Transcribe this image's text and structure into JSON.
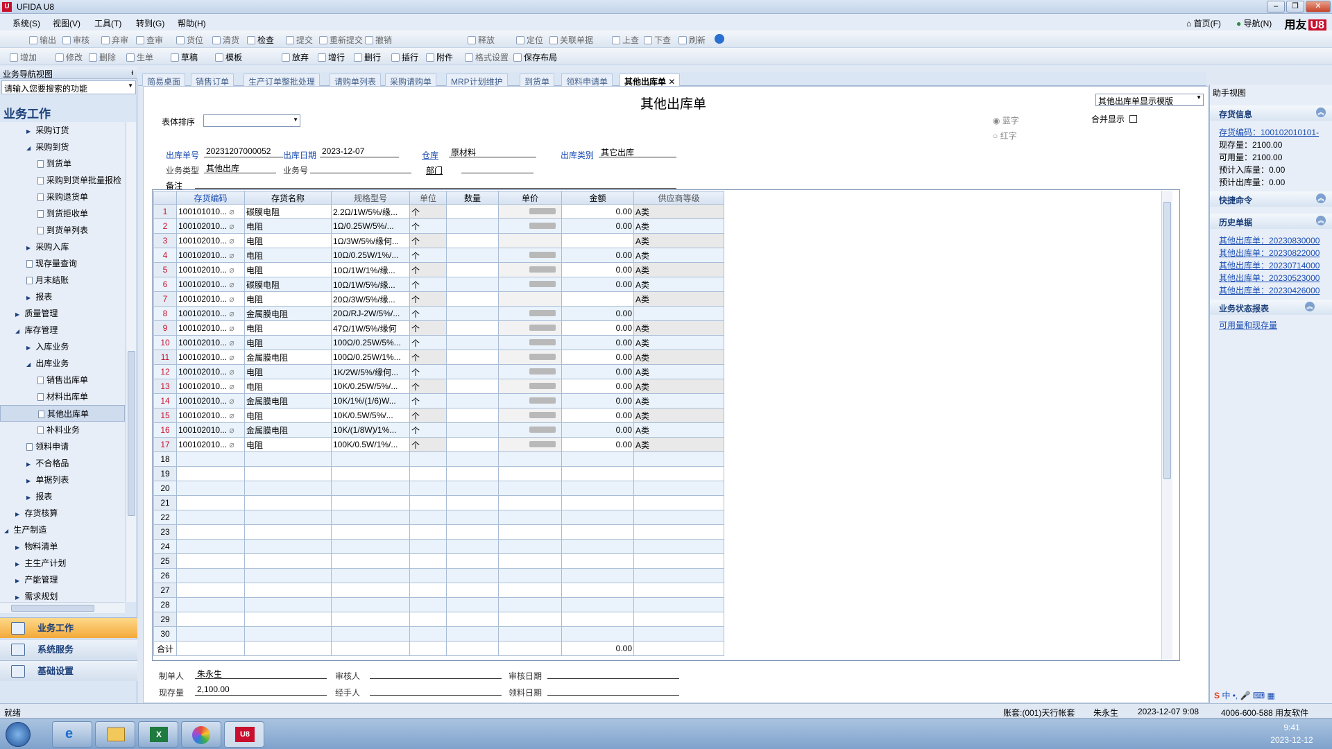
{
  "window": {
    "title": "UFIDA U8"
  },
  "menu": [
    "系统(S)",
    "视图(V)",
    "工具(T)",
    "转到(G)",
    "帮助(H)"
  ],
  "menu_right": {
    "home": "首页(F)",
    "nav": "导航(N)",
    "brand": "用友",
    "brand_mark": "U8"
  },
  "toolbar1": [
    "输出",
    "审核",
    "弃审",
    "查审",
    "货位",
    "清货",
    "检查",
    "提交",
    "重新提交",
    "撤销",
    "释放",
    "定位",
    "关联单据",
    "上查",
    "下查",
    "刷新"
  ],
  "toolbar2": [
    "增加",
    "修改",
    "删除",
    "生单",
    "草稿",
    "模板",
    "放弃",
    "增行",
    "删行",
    "插行",
    "附件",
    "格式设置",
    "保存布局"
  ],
  "left": {
    "header": "业务导航视图",
    "search_value": "请输入您要搜索的功能",
    "section_title": "业务工作",
    "tree": [
      {
        "label": "采购订货",
        "level": 2,
        "kind": "folder"
      },
      {
        "label": "采购到货",
        "level": 2,
        "kind": "open"
      },
      {
        "label": "到货单",
        "level": 3,
        "kind": "doc"
      },
      {
        "label": "采购到货单批量报检",
        "level": 3,
        "kind": "doc"
      },
      {
        "label": "采购退货单",
        "level": 3,
        "kind": "doc"
      },
      {
        "label": "到货拒收单",
        "level": 3,
        "kind": "doc"
      },
      {
        "label": "到货单列表",
        "level": 3,
        "kind": "doc"
      },
      {
        "label": "采购入库",
        "level": 2,
        "kind": "folder"
      },
      {
        "label": "现存量查询",
        "level": 2,
        "kind": "doc"
      },
      {
        "label": "月末结账",
        "level": 2,
        "kind": "doc"
      },
      {
        "label": "报表",
        "level": 2,
        "kind": "folder"
      },
      {
        "label": "质量管理",
        "level": 1,
        "kind": "folder"
      },
      {
        "label": "库存管理",
        "level": 1,
        "kind": "open"
      },
      {
        "label": "入库业务",
        "level": 2,
        "kind": "folder"
      },
      {
        "label": "出库业务",
        "level": 2,
        "kind": "open"
      },
      {
        "label": "销售出库单",
        "level": 3,
        "kind": "doc"
      },
      {
        "label": "材料出库单",
        "level": 3,
        "kind": "doc"
      },
      {
        "label": "其他出库单",
        "level": 3,
        "kind": "doc",
        "selected": true
      },
      {
        "label": "补料业务",
        "level": 3,
        "kind": "doc"
      },
      {
        "label": "领料申请",
        "level": 2,
        "kind": "doc"
      },
      {
        "label": "不合格品",
        "level": 2,
        "kind": "folder"
      },
      {
        "label": "单据列表",
        "level": 2,
        "kind": "folder"
      },
      {
        "label": "报表",
        "level": 2,
        "kind": "folder"
      },
      {
        "label": "存货核算",
        "level": 1,
        "kind": "folder"
      },
      {
        "label": "生产制造",
        "level": 0,
        "kind": "open"
      },
      {
        "label": "物料清单",
        "level": 1,
        "kind": "folder"
      },
      {
        "label": "主生产计划",
        "level": 1,
        "kind": "folder"
      },
      {
        "label": "产能管理",
        "level": 1,
        "kind": "folder"
      },
      {
        "label": "需求规划",
        "level": 1,
        "kind": "folder"
      }
    ],
    "nav_buttons": [
      "业务工作",
      "系统服务",
      "基础设置"
    ]
  },
  "tabs": [
    "简易桌面",
    "销售订单",
    "生产订单整批处理",
    "请购单列表",
    "采购请购单",
    "MRP计划维护",
    "到货单",
    "领料申请单",
    "其他出库单"
  ],
  "form": {
    "title": "其他出库单",
    "template": "其他出库单显示模版",
    "sort_label": "表体排序",
    "blue_label": "蓝字",
    "red_label": "红字",
    "merge_label": "合并显示",
    "fields": {
      "no_label": "出库单号",
      "no": "20231207000052",
      "date_label": "出库日期",
      "date": "2023-12-07",
      "wh_label": "仓库",
      "wh": "原材料",
      "cat_label": "出库类别",
      "cat": "其它出库",
      "biz_label": "业务类型",
      "biz": "其他出库",
      "bizno_label": "业务号",
      "bizno": "",
      "dept_label": "部门",
      "dept": "",
      "note_label": "备注",
      "note": ""
    },
    "columns": [
      "",
      "存货编码",
      "存货名称",
      "规格型号",
      "单位",
      "数量",
      "单价",
      "金额",
      "供应商等级"
    ],
    "rows": [
      {
        "n": "1",
        "code": "100101010...",
        "name": "碳膜电阻",
        "spec": "2.2Ω/1W/5%/缘...",
        "unit": "个",
        "amt": "0.00",
        "grade": "A类",
        "p": 1
      },
      {
        "n": "2",
        "code": "100102010...",
        "name": "电阻",
        "spec": "1Ω/0.25W/5%/...",
        "unit": "个",
        "amt": "0.00",
        "grade": "A类",
        "p": 1
      },
      {
        "n": "3",
        "code": "100102010...",
        "name": "电阻",
        "spec": "1Ω/3W/5%/缘何...",
        "unit": "个",
        "amt": "",
        "grade": "A类",
        "p": 0
      },
      {
        "n": "4",
        "code": "100102010...",
        "name": "电阻",
        "spec": "10Ω/0.25W/1%/...",
        "unit": "个",
        "amt": "0.00",
        "grade": "A类",
        "p": 1
      },
      {
        "n": "5",
        "code": "100102010...",
        "name": "电阻",
        "spec": "10Ω/1W/1%/缘...",
        "unit": "个",
        "amt": "0.00",
        "grade": "A类",
        "p": 1
      },
      {
        "n": "6",
        "code": "100102010...",
        "name": "碳膜电阻",
        "spec": "10Ω/1W/5%/缘...",
        "unit": "个",
        "amt": "0.00",
        "grade": "A类",
        "p": 1
      },
      {
        "n": "7",
        "code": "100102010...",
        "name": "电阻",
        "spec": "20Ω/3W/5%/缘...",
        "unit": "个",
        "amt": "",
        "grade": "A类",
        "p": 0
      },
      {
        "n": "8",
        "code": "100102010...",
        "name": "金属膜电阻",
        "spec": "20Ω/RJ-2W/5%/...",
        "unit": "个",
        "amt": "0.00",
        "grade": "",
        "p": 1
      },
      {
        "n": "9",
        "code": "100102010...",
        "name": "电阻",
        "spec": "47Ω/1W/5%/缘何",
        "unit": "个",
        "amt": "0.00",
        "grade": "A类",
        "p": 1
      },
      {
        "n": "10",
        "code": "100102010...",
        "name": "电阻",
        "spec": "100Ω/0.25W/5%...",
        "unit": "个",
        "amt": "0.00",
        "grade": "A类",
        "p": 1
      },
      {
        "n": "11",
        "code": "100102010...",
        "name": "金属膜电阻",
        "spec": "100Ω/0.25W/1%...",
        "unit": "个",
        "amt": "0.00",
        "grade": "A类",
        "p": 1
      },
      {
        "n": "12",
        "code": "100102010...",
        "name": "电阻",
        "spec": "1K/2W/5%/缘何...",
        "unit": "个",
        "amt": "0.00",
        "grade": "A类",
        "p": 1
      },
      {
        "n": "13",
        "code": "100102010...",
        "name": "电阻",
        "spec": "10K/0.25W/5%/...",
        "unit": "个",
        "amt": "0.00",
        "grade": "A类",
        "p": 1
      },
      {
        "n": "14",
        "code": "100102010...",
        "name": "金属膜电阻",
        "spec": "10K/1%/(1/6)W...",
        "unit": "个",
        "amt": "0.00",
        "grade": "A类",
        "p": 1
      },
      {
        "n": "15",
        "code": "100102010...",
        "name": "电阻",
        "spec": "10K/0.5W/5%/...",
        "unit": "个",
        "amt": "0.00",
        "grade": "A类",
        "p": 1
      },
      {
        "n": "16",
        "code": "100102010...",
        "name": "金属膜电阻",
        "spec": "10K/(1/8W)/1%...",
        "unit": "个",
        "amt": "0.00",
        "grade": "A类",
        "p": 1
      },
      {
        "n": "17",
        "code": "100102010...",
        "name": "电阻",
        "spec": "100K/0.5W/1%/...",
        "unit": "个",
        "amt": "0.00",
        "grade": "A类",
        "p": 1
      }
    ],
    "empty_rows": [
      "18",
      "19",
      "20",
      "21",
      "22",
      "23",
      "24",
      "25",
      "26",
      "27",
      "28",
      "29",
      "30"
    ],
    "total_label": "合计",
    "total_amount": "0.00",
    "footer": {
      "maker_label": "制单人",
      "maker": "朱永生",
      "auditor_label": "审核人",
      "auditor": "",
      "audit_date_label": "审核日期",
      "audit_date": "",
      "stock_label": "现存量",
      "stock": "2,100.00",
      "handler_label": "经手人",
      "handler": "",
      "pick_date_label": "领料日期",
      "pick_date": ""
    }
  },
  "right": {
    "header": "助手视图",
    "inv_title": "存货信息",
    "inv_code": "存货编码：100102010101-",
    "inv_lines": [
      "现存量：2100.00",
      "可用量：2100.00",
      "预计入库量：0.00",
      "预计出库量：0.00"
    ],
    "quick_title": "快捷命令",
    "hist_title": "历史单据",
    "hist_links": [
      "其他出库单：20230830000",
      "其他出库单：20230822000",
      "其他出库单：20230714000",
      "其他出库单：20230523000",
      "其他出库单：20230426000"
    ],
    "report_title": "业务状态报表",
    "report_link": "可用量和现存量"
  },
  "status": {
    "left": "就绪",
    "account": "账套:(001)天行帐套",
    "user": "朱永生",
    "date": "2023-12-07 9:08",
    "phone": "4006-600-588 用友软件"
  },
  "taskbar": {
    "time": "9:41",
    "date": "2023-12-12",
    "ime": "中"
  }
}
